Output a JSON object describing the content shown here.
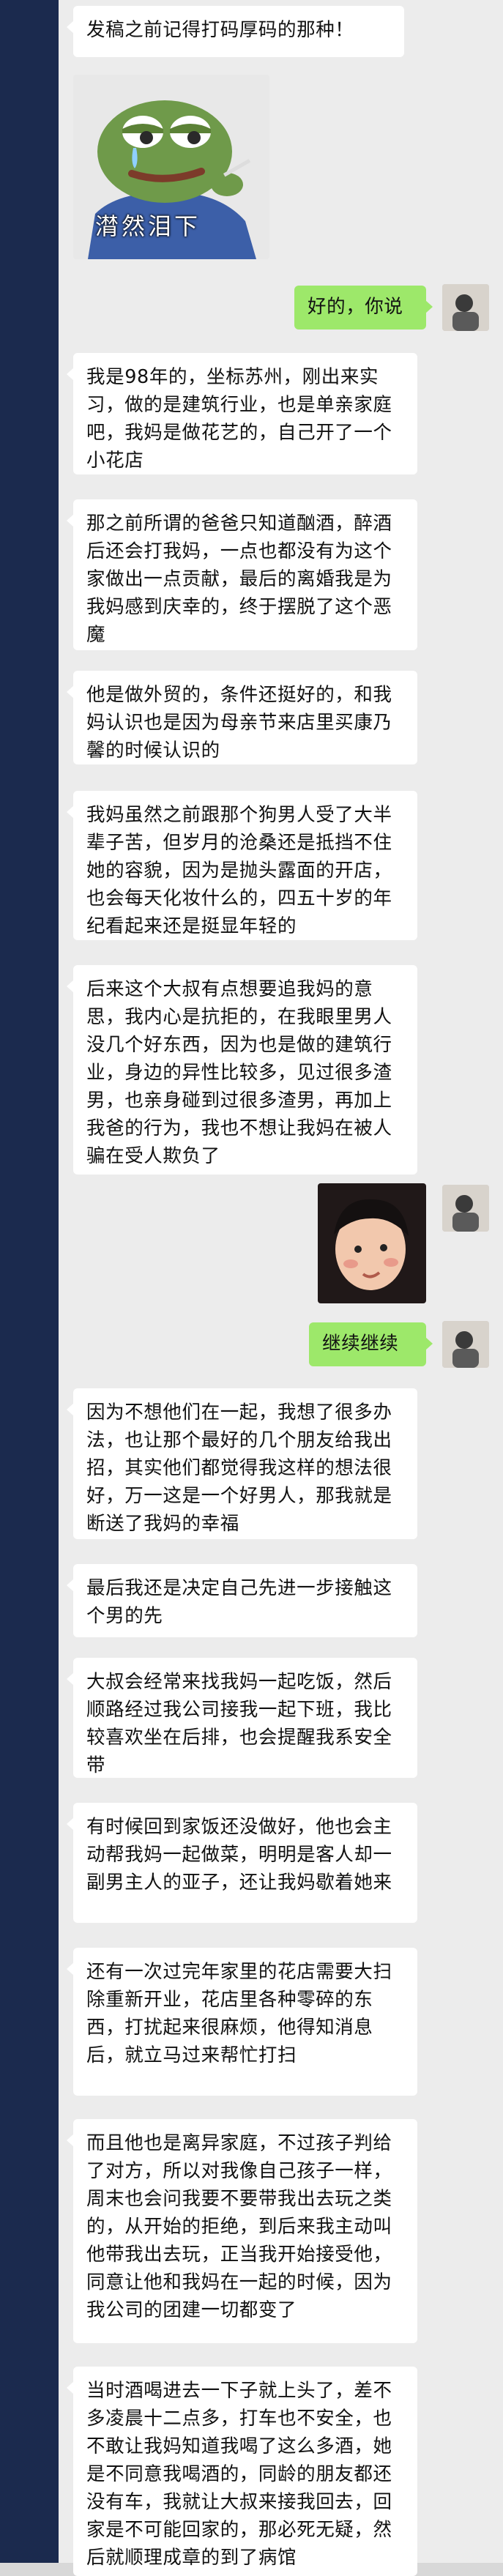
{
  "theme": {
    "sidebar_color": "#1b2a4e",
    "chat_background": "#ececec",
    "incoming_bubble": "#ffffff",
    "outgoing_bubble": "#9de86a"
  },
  "messages": {
    "m0": "发稿之前记得打码厚码的那种！",
    "sticker_caption": "潸然泪下",
    "r1": "好的，你说",
    "m1": "我是98年的，坐标苏州，刚出来实习，做的是建筑行业，也是单亲家庭吧，我妈是做花艺的，自己开了一个小花店",
    "m2": "那之前所谓的爸爸只知道酗酒，醉酒后还会打我妈，一点也都没有为这个家做出一点贡献，最后的离婚我是为我妈感到庆幸的，终于摆脱了这个恶魔",
    "m3": "他是做外贸的，条件还挺好的，和我妈认识也是因为母亲节来店里买康乃馨的时候认识的",
    "m4": "我妈虽然之前跟那个狗男人受了大半辈子苦，但岁月的沧桑还是抵挡不住她的容貌，因为是抛头露面的开店，也会每天化妆什么的，四五十岁的年纪看起来还是挺显年轻的",
    "m5": "后来这个大叔有点想要追我妈的意思，我内心是抗拒的，在我眼里男人没几个好东西，因为也是做的建筑行业，身边的异性比较多，见过很多渣男，也亲身碰到过很多渣男，再加上我爸的行为，我也不想让我妈在被人骗在受人欺负了",
    "r2": "继续继续",
    "m6": "因为不想他们在一起，我想了很多办法，也让那个最好的几个朋友给我出招，其实他们都觉得我这样的想法很好，万一这是一个好男人，那我就是断送了我妈的幸福",
    "m7": "最后我还是决定自己先进一步接触这个男的先",
    "m8": "大叔会经常来找我妈一起吃饭，然后顺路经过我公司接我一起下班，我比较喜欢坐在后排，也会提醒我系安全带",
    "m9": "有时候回到家饭还没做好，他也会主动帮我妈一起做菜，明明是客人却一副男主人的亚子，还让我妈歇着她来",
    "m10": "还有一次过完年家里的花店需要大扫除重新开业，花店里各种零碎的东西，打扰起来很麻烦，他得知消息后，就立马过来帮忙打扫",
    "m11": "而且他也是离异家庭，不过孩子判给了对方，所以对我像自己孩子一样，周末也会问我要不要带我出去玩之类的，从开始的拒绝，到后来我主动叫他带我出去玩，正当我开始接受他，同意让他和我妈在一起的时候，因为我公司的团建一切都变了",
    "m12": "当时酒喝进去一下子就上头了，差不多凌晨十二点多，打车也不安全，也不敢让我妈知道我喝了这么多酒，她是不同意我喝酒的，同龄的朋友都还没有车，我就让大叔来接我回去，回家是不可能回家的，那必死无疑，然后就顺理成章的到了病馆"
  }
}
